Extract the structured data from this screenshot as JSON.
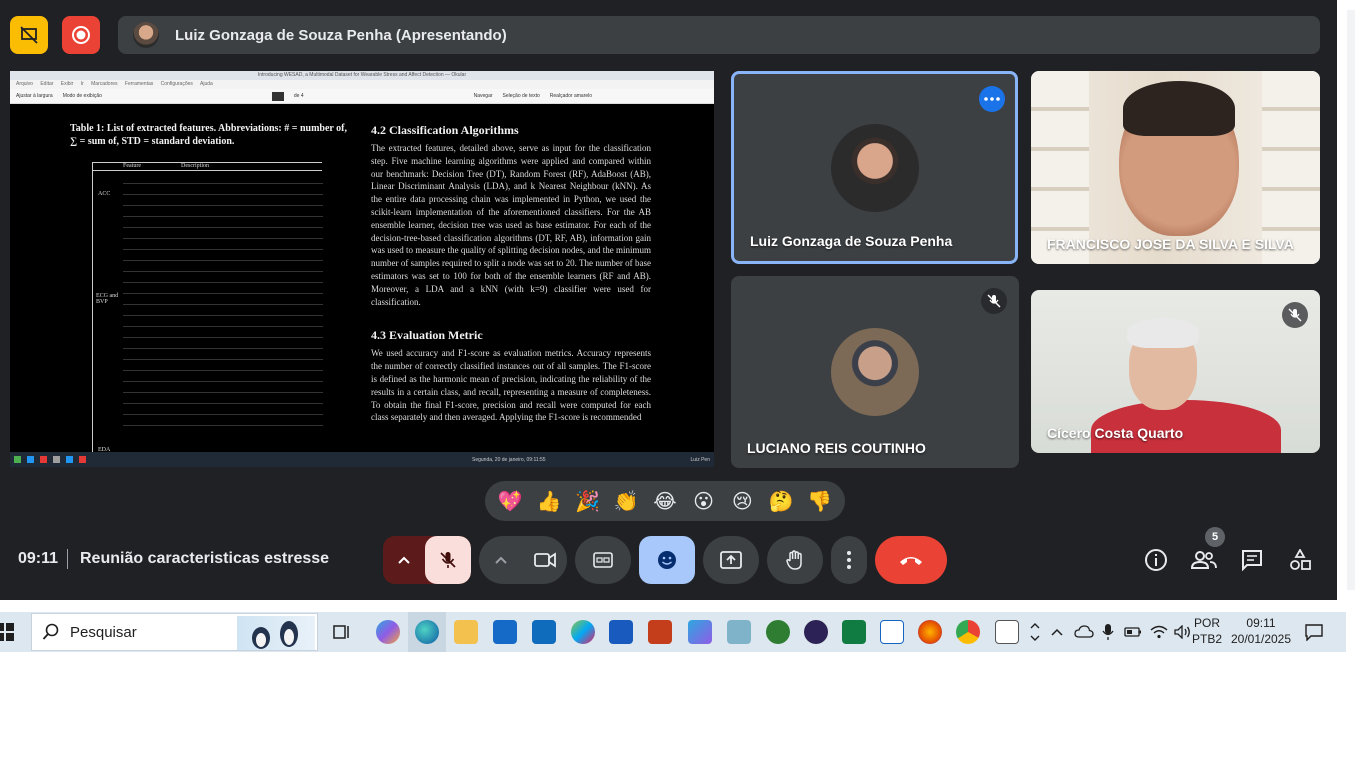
{
  "presenter_bar": {
    "text": "Luiz Gonzaga de Souza Penha (Apresentando)"
  },
  "shared_screen": {
    "window_title": "Introducing WESAD, a Multimodal Dataset for Wearable Stress and Affect Detection — Okular",
    "menu": "Arquivo Editar Exibir Ir Marcadores Ferramentas Configurações Ajuda",
    "toolbar_zoom": "Ajustar à largura",
    "toolbar_mode": "Modo de exibição",
    "toolbar_page_of": "de 4",
    "toolbar_browse": "Navegar",
    "toolbar_text_select": "Seleção de texto",
    "toolbar_highlight": "Realçador amarelo",
    "table_caption": "Table 1: List of extracted features. Abbreviations: # = number of, ∑ = sum of, STD = standard deviation.",
    "table_head_feature": "Feature",
    "table_head_description": "Description",
    "group_acc": "ACC",
    "group_ecg": "ECG and BVP",
    "group_eda": "EDA",
    "section_4_2_title": "4.2   Classification Algorithms",
    "section_4_2_body": "The extracted features, detailed above, serve as input for the classification step. Five machine learning algorithms were applied and compared within our benchmark: Decision Tree (DT), Random Forest (RF), AdaBoost (AB), Linear Discriminant Analysis (LDA), and k Nearest Neighbour (kNN). As the entire data processing chain was implemented in Python, we used the scikit-learn implementation of the aforementioned classifiers. For the AB ensemble learner, decision tree was used as base estimator. For each of the decision-tree-based classification algorithms (DT, RF, AB), information gain was used to measure the quality of splitting decision nodes, and the minimum number of samples required to split a node was set to 20. The number of base estimators was set to 100 for both of the ensemble learners (RF and AB). Moreover, a LDA and a kNN (with k=9) classifier were used for classification.",
    "section_4_3_title": "4.3   Evaluation Metric",
    "section_4_3_body": "We used accuracy and F1-score as evaluation metrics. Accuracy represents the number of correctly classified instances out of all samples. The F1-score is defined as the harmonic mean of precision, indicating the reliability of the results in a certain class, and recall, representing a measure of completeness. To obtain the final F1-score, precision and recall were computed for each class separately and then averaged. Applying the F1-score is recommended",
    "taskbar_datetime": "Segunda, 20 de janeiro, 09:11:55",
    "taskbar_user": "Luiz Pen"
  },
  "participants": [
    {
      "name": "Luiz Gonzaga de Souza Penha",
      "state": "speaking"
    },
    {
      "name": "FRANCISCO JOSE DA SILVA E SILVA",
      "state": "video"
    },
    {
      "name": "LUCIANO REIS COUTINHO",
      "state": "muted"
    },
    {
      "name": "Cícero Costa Quarto",
      "state": "muted"
    }
  ],
  "reactions": [
    "💖",
    "👍",
    "🎉",
    "👏",
    "😂",
    "😮",
    "😢",
    "🤔",
    "👎"
  ],
  "meeting": {
    "time": "09:11",
    "title": "Reunião caracteristicas estresse",
    "people_count": "5"
  },
  "windows_taskbar": {
    "search_placeholder": "Pesquisar",
    "language_top": "POR",
    "language_bottom": "PTB2",
    "clock_time": "09:11",
    "clock_date": "20/01/2025"
  },
  "colors": {
    "meet_background": "#202124",
    "active_speaker_border": "#8ab4f8",
    "leave_button": "#ea4335",
    "emoji_button_active": "#a8c7fa",
    "mic_off_button": "#f9dedc"
  }
}
